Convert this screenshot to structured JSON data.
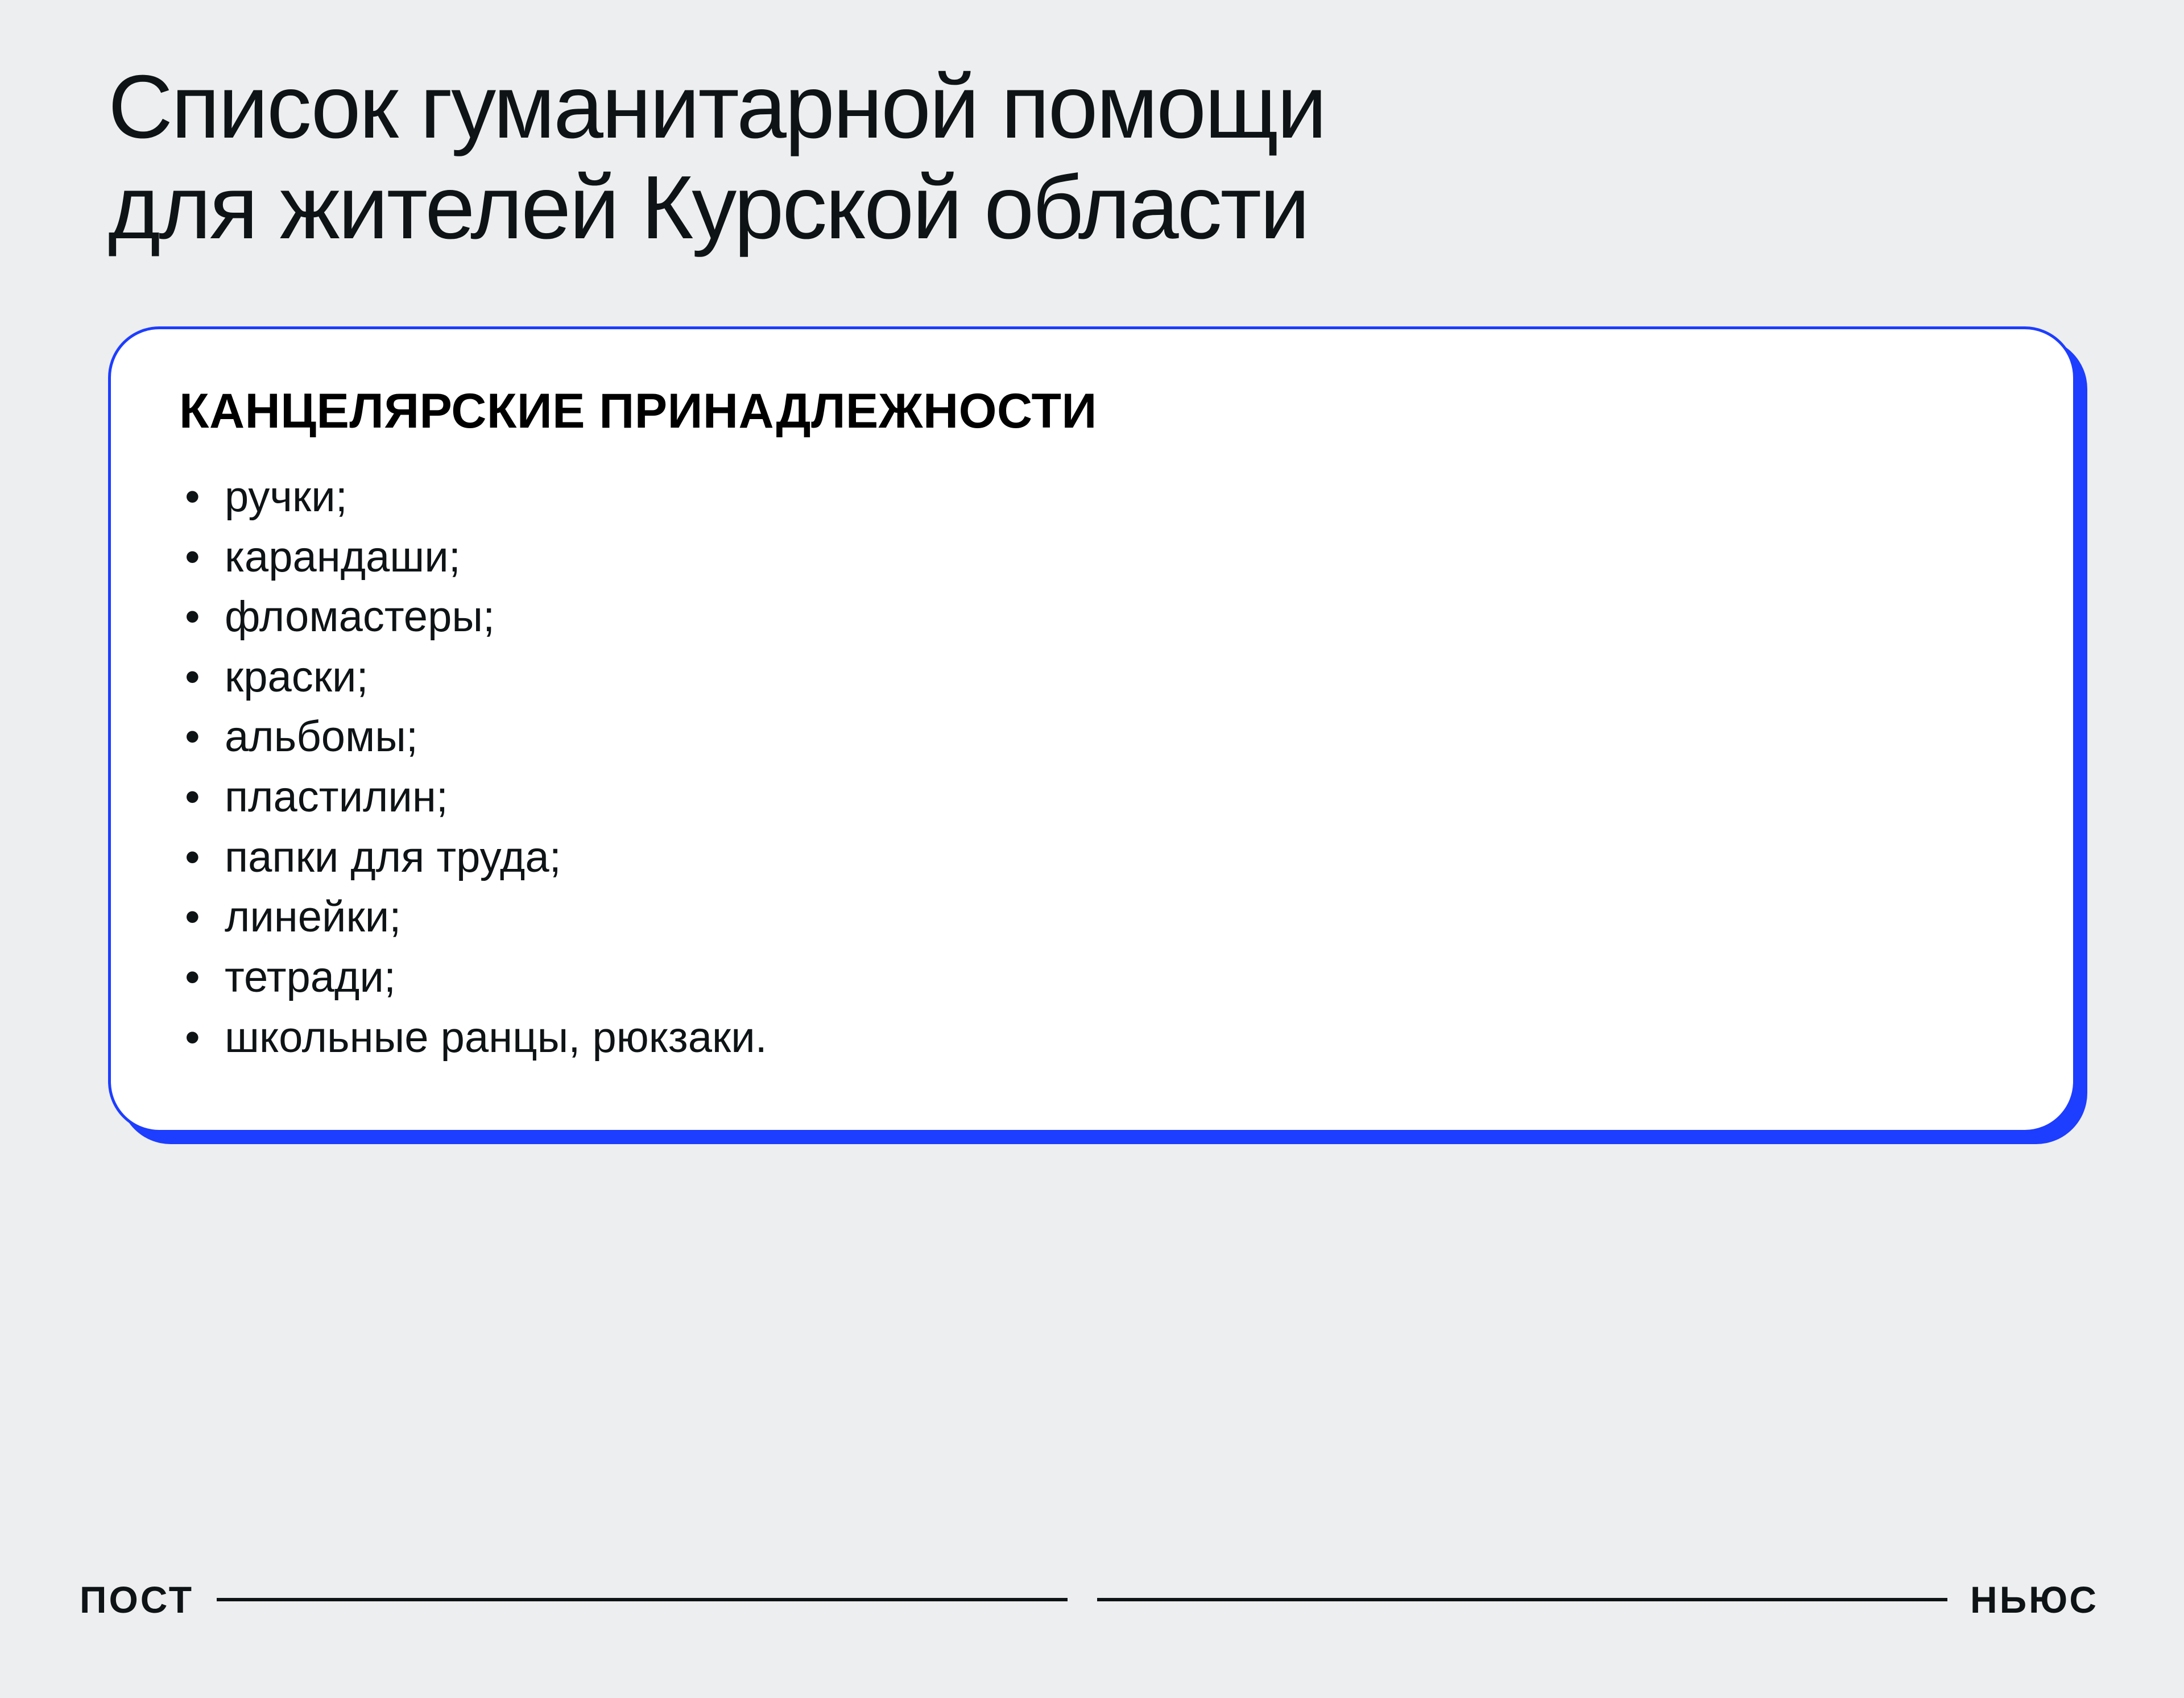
{
  "header": {
    "title_line1": "Список гуманитарной помощи",
    "title_line2": "для жителей Курской области"
  },
  "card": {
    "title": "КАНЦЕЛЯРСКИЕ ПРИНАДЛЕЖНОСТИ",
    "items": [
      "ручки;",
      "карандаши;",
      "фломастеры;",
      "краски;",
      "альбомы;",
      "пластилин;",
      "папки для труда;",
      "линейки;",
      "тетради;",
      "школьные ранцы, рюкзаки."
    ]
  },
  "footer": {
    "left": "ПОСТ",
    "right": "НЬЮС"
  },
  "colors": {
    "background": "#edeeef",
    "accent": "#1d3dff",
    "text": "#0e1315",
    "card_bg": "#ffffff"
  }
}
